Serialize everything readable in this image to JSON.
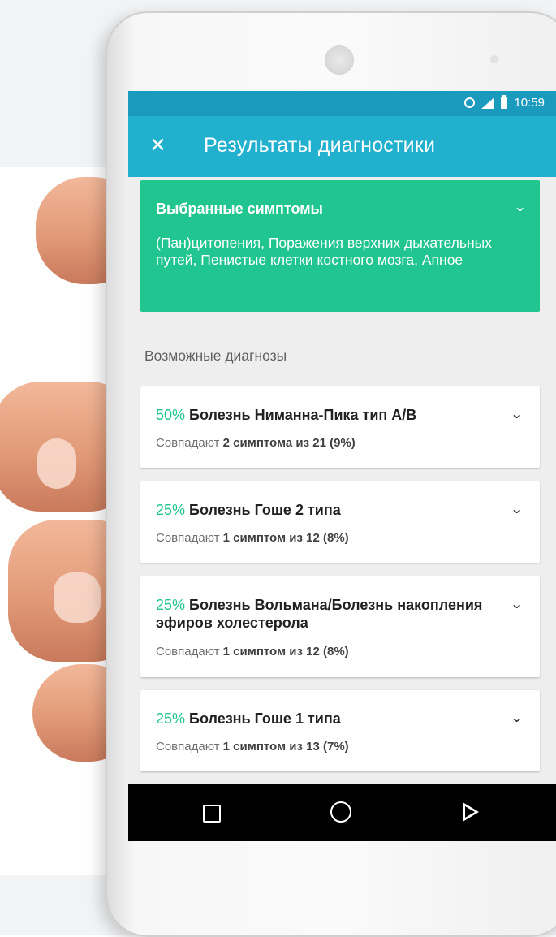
{
  "status_bar": {
    "time": "10:59"
  },
  "app_bar": {
    "close_icon": "close-icon",
    "title": "Результаты диагностики"
  },
  "symptoms_card": {
    "title": "Выбранные симптомы",
    "text": "(Пан)цитопения, Поражения верхних дыхательных путей, Пенистые клетки костного мозга, Апное",
    "color": "#21c58f"
  },
  "section_title": "Возможные диагнозы",
  "diagnoses": [
    {
      "percent": "50%",
      "name": "Болезнь Ниманна-Пика тип A/B",
      "match_prefix": "Совпадают",
      "match_detail": "2 симптома из 21 (9%)"
    },
    {
      "percent": "25%",
      "name": "Болезнь Гоше 2 типа",
      "match_prefix": "Совпадают",
      "match_detail": "1 симптом из 12 (8%)"
    },
    {
      "percent": "25%",
      "name": "Болезнь Вольмана/Болезнь накопления эфиров холестерола",
      "match_prefix": "Совпадают",
      "match_detail": "1 симптом из 12 (8%)"
    },
    {
      "percent": "25%",
      "name": "Болезнь Гоше 1 типа",
      "match_prefix": "Совпадают",
      "match_detail": "1 симптом из 13 (7%)"
    }
  ],
  "nav_bar": {
    "icons": [
      "recent-apps-icon",
      "home-icon",
      "back-icon"
    ]
  },
  "colors": {
    "status_bar": "#1a9bbd",
    "app_bar": "#22b0cf",
    "accent": "#21c58f"
  }
}
